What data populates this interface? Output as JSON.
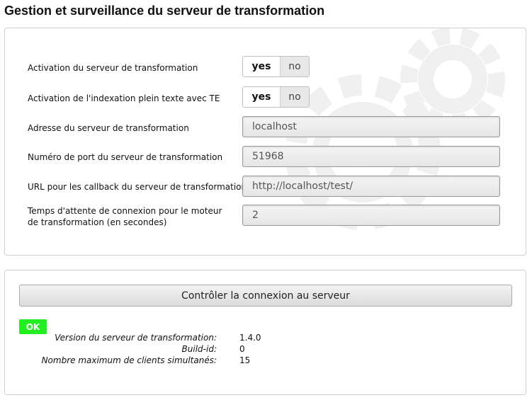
{
  "page": {
    "title": "Gestion et surveillance du serveur de transformation"
  },
  "config": {
    "server_activation": {
      "label": "Activation du serveur de transformation",
      "yes": "yes",
      "no": "no",
      "selected": "yes"
    },
    "fulltext_indexing": {
      "label": "Activation de l'indexation plein texte avec TE",
      "yes": "yes",
      "no": "no",
      "selected": "yes"
    },
    "server_address": {
      "label": "Adresse du serveur de transformation",
      "value": "localhost"
    },
    "server_port": {
      "label": "Numéro de port du serveur de transformation",
      "value": "51968"
    },
    "callback_url": {
      "label": "URL pour les callback du serveur de transformation",
      "value": "http://localhost/test/"
    },
    "connection_timeout": {
      "label": "Temps d'attente de connexion pour le moteur de transformation (en secondes)",
      "value": "2"
    }
  },
  "status": {
    "check_button_label": "Contrôler la connexion au serveur",
    "result_badge": "OK",
    "result_color": "#22ee22",
    "info": [
      {
        "label": "Version du serveur de transformation:",
        "value": "1.4.0"
      },
      {
        "label": "Build-id:",
        "value": "0"
      },
      {
        "label": "Nombre maximum de clients simultanés:",
        "value": "15"
      }
    ]
  },
  "icons": {
    "background": "gear-watermark-icon"
  }
}
